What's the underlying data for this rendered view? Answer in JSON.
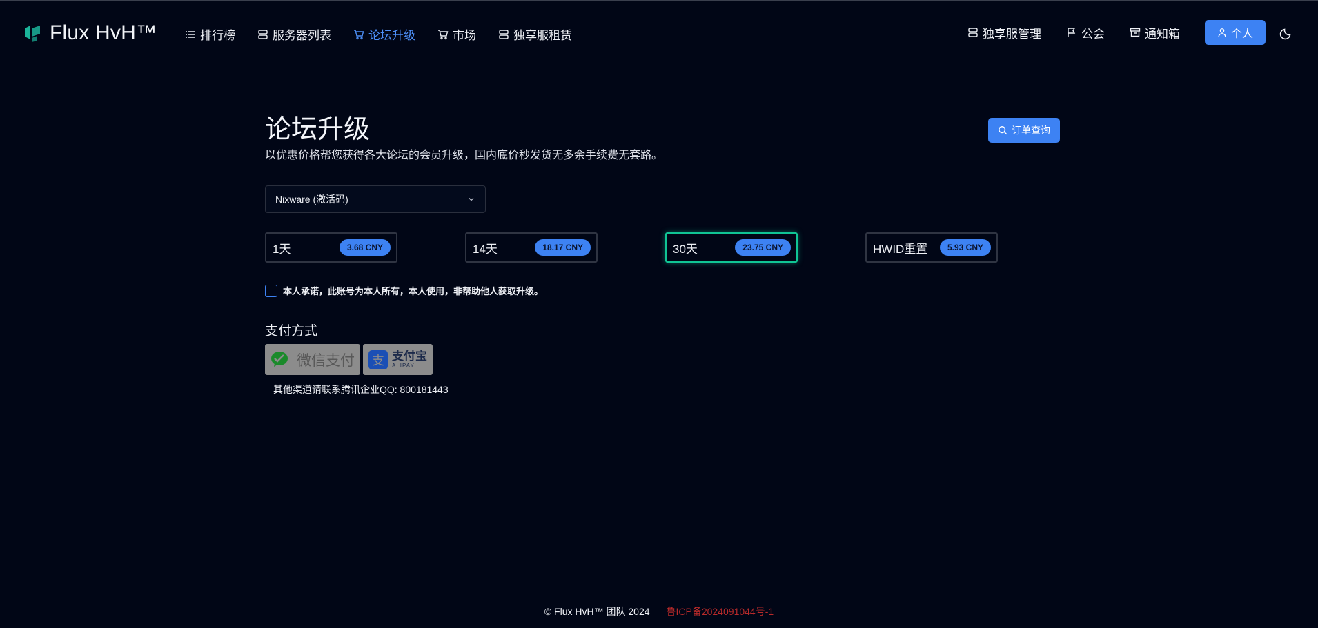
{
  "brand": {
    "name": "Flux HvH™",
    "color": "#1bb49a"
  },
  "nav": {
    "left": [
      {
        "label": "排行榜",
        "icon": "list-icon"
      },
      {
        "label": "服务器列表",
        "icon": "server-icon"
      },
      {
        "label": "论坛升级",
        "icon": "cart-icon",
        "active": true
      },
      {
        "label": "市场",
        "icon": "cart-icon"
      },
      {
        "label": "独享服租赁",
        "icon": "server-icon"
      }
    ],
    "right": [
      {
        "label": "独享服管理",
        "icon": "server-icon"
      },
      {
        "label": "公会",
        "icon": "flag-icon"
      },
      {
        "label": "通知箱",
        "icon": "archive-icon"
      }
    ],
    "personal_label": "个人"
  },
  "page": {
    "title": "论坛升级",
    "subtitle": "以优惠价格帮您获得各大论坛的会员升级，国内底价秒发货无多余手续费无套路。",
    "order_query_label": "订单查询",
    "selected_product": "Nixware (激活码)"
  },
  "plans": [
    {
      "label": "1天",
      "price": "3.68 CNY",
      "selected": false
    },
    {
      "label": "14天",
      "price": "18.17 CNY",
      "selected": false
    },
    {
      "label": "30天",
      "price": "23.75 CNY",
      "selected": true
    },
    {
      "label": "HWID重置",
      "price": "5.93 CNY",
      "selected": false
    }
  ],
  "agreement": {
    "text": "本人承诺，此账号为本人所有，本人使用，非帮助他人获取升级。",
    "checked": false
  },
  "payment": {
    "title": "支付方式",
    "wechat_label": "微信支付",
    "alipay_cn": "支付宝",
    "alipay_en": "ALIPAY",
    "other_contact": "其他渠道请联系腾讯企业QQ: 800181443"
  },
  "footer": {
    "copyright": "© Flux HvH™ 团队 2024",
    "icp": "鲁ICP备2024091044号-1"
  },
  "colors": {
    "accent": "#3d82f3",
    "selected_border": "#10c494",
    "background": "#010616",
    "icp": "#b82a2a"
  }
}
